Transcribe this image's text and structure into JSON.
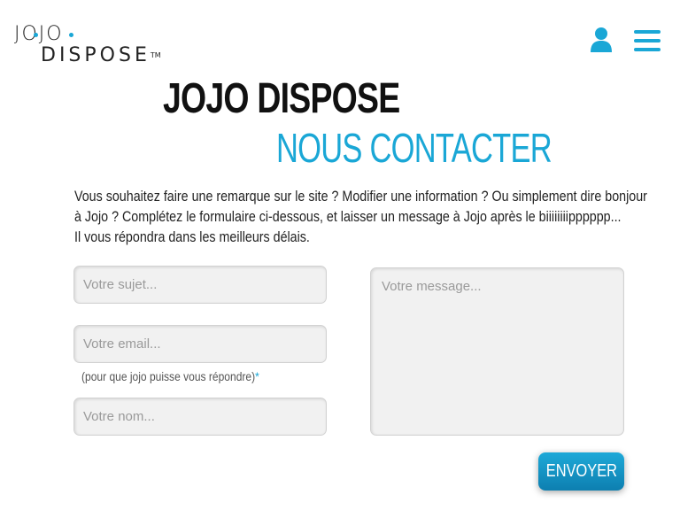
{
  "header": {
    "logo_top": "JOJO",
    "logo_bottom": "DISPOSE",
    "logo_tm": "TM",
    "user_icon": "user-icon",
    "menu_icon": "hamburger-menu-icon",
    "accent_color": "#1aa7d6"
  },
  "main": {
    "title": "JOJO DISPOSE",
    "subtitle": "NOUS CONTACTER",
    "intro_lines": [
      "Vous souhaitez faire une remarque sur le site ? Modifier une information ? Ou simplement dire bonjour",
      "à Jojo ? Complétez le formulaire ci-dessous, et laisser un message à Jojo après le biiiiiiiipppppp...",
      "Il vous répondra dans les meilleurs délais."
    ]
  },
  "form": {
    "subject_placeholder": "Votre sujet...",
    "email_placeholder": "Votre email...",
    "email_hint": "(pour que jojo puisse vous répondre)",
    "email_hint_star": "*",
    "name_placeholder": "Votre nom...",
    "message_placeholder": "Votre message...",
    "submit_label": "ENVOYER"
  }
}
